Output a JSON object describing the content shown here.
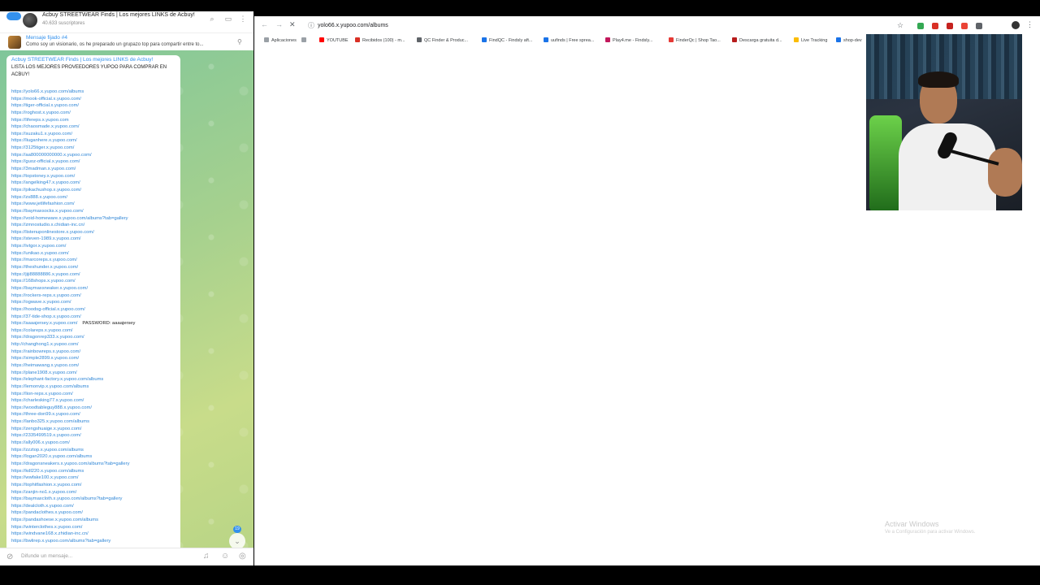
{
  "telegram": {
    "channel_title": "Acbuy STREETWEAR Finds | Los mejores LINKS de Acbuy!",
    "subscribers": "40.633 suscriptores",
    "back_badge": "",
    "pinned": {
      "title": "Mensaje fijado #4",
      "text": "Como soy un visionario, os he preparado un grupazo top para compartir entre to..."
    },
    "message": {
      "header": "Acbuy STREETWEAR Finds | Los mejores LINKS de Acbuy!",
      "intro": "LISTA LOS MEJORES PROVEEDORES YUPOO PARA COMPRAR EN ACBUY!",
      "links": [
        {
          "url": "https://yolo66.x.yupoo.com/albums"
        },
        {
          "url": "https://mook-official.x.yupoo.com/"
        },
        {
          "url": "https://tiger-official.x.yupoo.com/"
        },
        {
          "url": "https://roghost.x.yupoo.com/"
        },
        {
          "url": "https://lifereps.x.yupoo.com"
        },
        {
          "url": "https://chaosmade.x.yupoo.com/"
        },
        {
          "url": "https://suzaku1.x.yupoo.com/"
        },
        {
          "url": "https://liuganhere.x.yupoo.com/"
        },
        {
          "url": "https://3125tiger.x.yupoo.com/"
        },
        {
          "url": "https://aa800000000000.x.yupoo.com/"
        },
        {
          "url": "https://guoz-official.x.yupoo.com/"
        },
        {
          "url": "https://3madman.x.yupoo.com/"
        },
        {
          "url": "https://topstoney.x.yupoo.com/"
        },
        {
          "url": "https://angelking47.x.yupoo.com/"
        },
        {
          "url": "https://pikachushop.x.yupoo.com/"
        },
        {
          "url": "https://zs888.x.yupoo.com/"
        },
        {
          "url": "https://www.jetlifefashion.com/"
        },
        {
          "url": "https://baymaxsocks.x.yupoo.com/"
        },
        {
          "url": "https://void-homeware.x.yupoo.com/albums?tab=gallery"
        },
        {
          "url": "https://zmnostudio.x.chidian-inc.cn/"
        },
        {
          "url": "https://listenuponlinestore.x.yupoo.com/"
        },
        {
          "url": "https://steven-1989.x.yupoo.com/"
        },
        {
          "url": "https://ivtgor.x.yupoo.com/"
        },
        {
          "url": "https://unikao.x.yupoo.com/"
        },
        {
          "url": "https://marcoreps.x.yupoo.com/"
        },
        {
          "url": "https://theshunder.x.yupoo.com/"
        },
        {
          "url": "https://jiji88888886.x.yupoo.com/"
        },
        {
          "url": "https://168shops.x.yupoo.com/"
        },
        {
          "url": "https://baymaxsneaker.x.yupoo.com/"
        },
        {
          "url": "https://rockers-reps.x.yupoo.com/"
        },
        {
          "url": "https://ogwave.x.yupoo.com/"
        },
        {
          "url": "https://hoodsg-official.x.yupoo.com/"
        },
        {
          "url": "https://37-tide-shop.x.yupoo.com/"
        },
        {
          "url": "https://aaaajersey.x.yupoo.com/",
          "note": "PASSWORD: aaaajersey"
        },
        {
          "url": "https://colareps.x.yupoo.com/"
        },
        {
          "url": "https://dragonrep333.x.yupoo.com/"
        },
        {
          "url": "http://changhong1.x.yupoo.com/"
        },
        {
          "url": "https://rainbowreps.x.yupoo.com/"
        },
        {
          "url": "https://simple2899.x.yupoo.com/"
        },
        {
          "url": "https://heimawang.x.yupoo.com/"
        },
        {
          "url": "https://plane1908.x.yupoo.com/"
        },
        {
          "url": "https://elephant-factory.x.yupoo.com/albums"
        },
        {
          "url": "https://lemonvip.x.yupoo.com/albums"
        },
        {
          "url": "https://lion-reps.x.yupoo.com/"
        },
        {
          "url": "https://charlesking77.x.yupoo.com/"
        },
        {
          "url": "https://woodtableguy888.x.yupoo.com/"
        },
        {
          "url": "https://three-don99.x.yupoo.com/"
        },
        {
          "url": "https://lanbo325.x.yupoo.com/albums"
        },
        {
          "url": "https://zengshuaige.x.yupoo.com/"
        },
        {
          "url": "https://2335499519.x.yupoo.com/"
        },
        {
          "url": "https://ally006.x.yupoo.com/"
        },
        {
          "url": "https://zzztop.x.yupoo.com/albums"
        },
        {
          "url": "https://logan2020.x.yupoo.com/albums"
        },
        {
          "url": "https://dragonsneakers.x.yupoo.com/albums?tab=gallery"
        },
        {
          "url": "https://kdl220.x.yupoo.com/albums"
        },
        {
          "url": "https://wwfake100.x.yupoo.com/"
        },
        {
          "url": "https://tophitfashion.x.yupoo.com/"
        },
        {
          "url": "https://zanjin-no1.x.yupoo.com/"
        },
        {
          "url": "https://baymaxcloth.x.yupoo.com/albums?tab=gallery"
        },
        {
          "url": "https://dealcloth.x.yupoo.com/"
        },
        {
          "url": "https://pandaclothes.x.yupoo.com/"
        },
        {
          "url": "https://pandashoese.x.yupoo.com/albums"
        },
        {
          "url": "https://winterclothes.x.yupoo.com/"
        },
        {
          "url": "https://windvane168.x.zhidian-inc.cn/"
        },
        {
          "url": "https://bwlirep.x.yupoo.com/albums?tab=gallery"
        }
      ]
    },
    "unread_count": "19",
    "input_placeholder": "Difunde un mensaje..."
  },
  "browser": {
    "url": "yolo66.x.yupoo.com/albums",
    "bookmarks": [
      {
        "label": "Aplicaciones",
        "color": "#9aa0a6"
      },
      {
        "label": "",
        "color": "#9aa0a6"
      },
      {
        "label": "YOUTUBE",
        "color": "#ff0000"
      },
      {
        "label": "Recibidos (100) - m...",
        "color": "#d93025"
      },
      {
        "label": "QC Finder & Produc...",
        "color": "#5f6368"
      },
      {
        "label": "FindQC - Findsly aft...",
        "color": "#1a73e8"
      },
      {
        "label": "uufinds | Free sprea...",
        "color": "#1a73e8"
      },
      {
        "label": "Play4.me - Findsly...",
        "color": "#c2185b"
      },
      {
        "label": "FinderQc | Shop Tao...",
        "color": "#e53935"
      },
      {
        "label": "Descarga gratuita d...",
        "color": "#b71c1c"
      },
      {
        "label": "Live Tracking",
        "color": "#fbbc04"
      },
      {
        "label": "shop-dev",
        "color": "#1a73e8"
      }
    ],
    "extension_colors": [
      "#34a853",
      "#d93025",
      "#c5221f",
      "#ea4335",
      "#5f6368"
    ],
    "watermark_title": "Activar Windows",
    "watermark_sub": "Ve a Configuración para activar Windows."
  }
}
